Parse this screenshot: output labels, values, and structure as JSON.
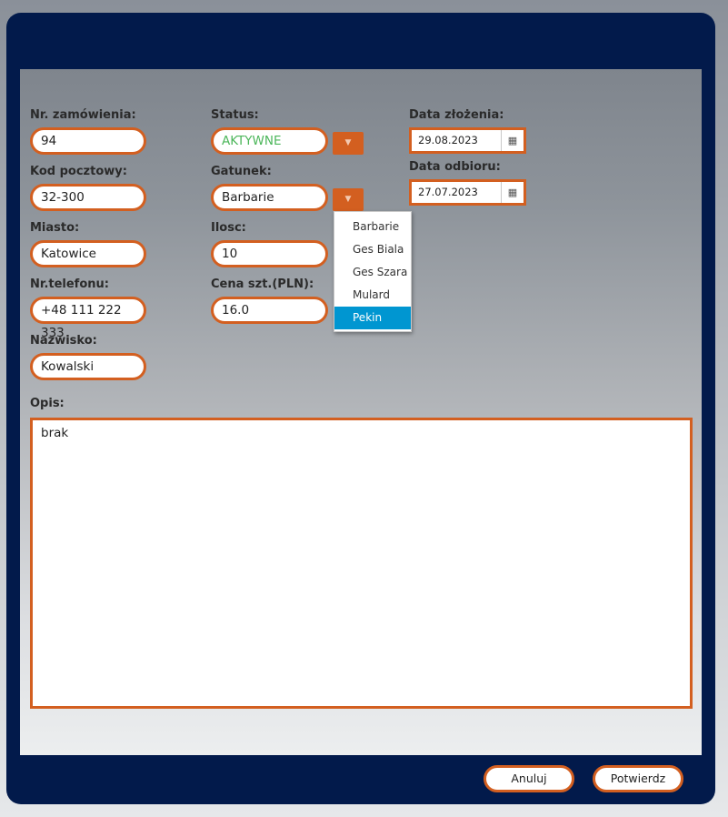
{
  "form": {
    "order_no": {
      "label": "Nr. zamówienia:",
      "value": "94"
    },
    "postal_code": {
      "label": "Kod pocztowy:",
      "value": "32-300"
    },
    "city": {
      "label": "Miasto:",
      "value": "Katowice"
    },
    "phone": {
      "label": "Nr.telefonu:",
      "value": "+48 111 222 333"
    },
    "surname": {
      "label": "Nazwisko:",
      "value": "Kowalski"
    },
    "status": {
      "label": "Status:",
      "value": "AKTYWNE"
    },
    "species": {
      "label": "Gatunek:",
      "value": "Barbarie"
    },
    "quantity": {
      "label": "Ilosc:",
      "value": "10"
    },
    "unit_price": {
      "label": "Cena szt.(PLN):",
      "value": "16.0"
    },
    "order_date": {
      "label": "Data złożenia:",
      "value": "29.08.2023"
    },
    "pickup_date": {
      "label": "Data odbioru:",
      "value": "27.07.2023"
    },
    "description": {
      "label": "Opis:",
      "value": "brak"
    }
  },
  "species_dropdown": {
    "options": [
      "Barbarie",
      "Ges Biala",
      "Ges Szara",
      "Mulard",
      "Pekin"
    ],
    "highlighted": "Pekin"
  },
  "icons": {
    "dropdown": "chevron-down-icon",
    "calendar": "calendar-icon"
  },
  "buttons": {
    "cancel": "Anuluj",
    "confirm": "Potwierdz"
  },
  "colors": {
    "window": "#021a4b",
    "accent": "#d35f20",
    "status_active": "#4cb65a",
    "selected_option": "#0096d1"
  }
}
